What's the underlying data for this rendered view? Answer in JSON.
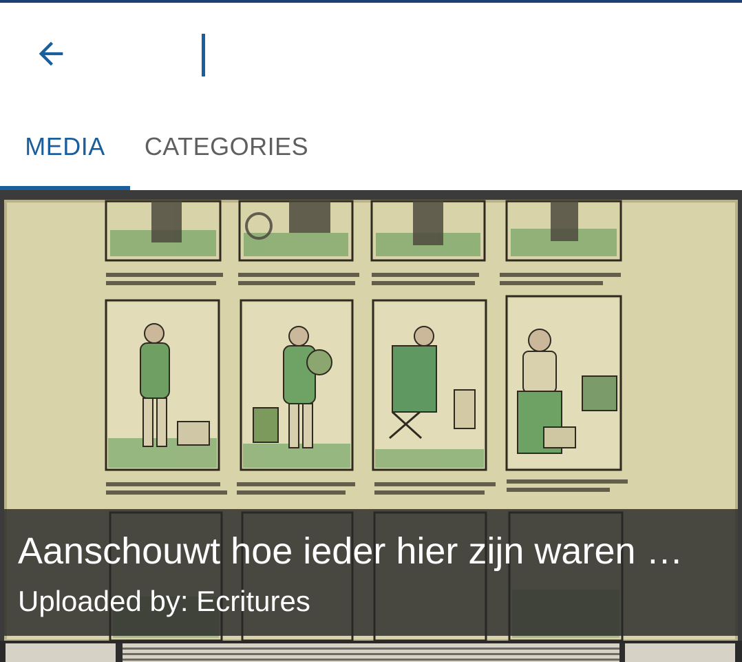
{
  "colors": {
    "accent": "#1b5e9c",
    "top_strip": "#1d3f72",
    "inactive_tab": "#5f5f5f",
    "caption_overlay": "#282828",
    "paper": "#d8d2a8"
  },
  "toolbar": {
    "back_icon": "arrow-left-icon",
    "search_value": "",
    "search_placeholder": ""
  },
  "tabs": [
    {
      "label": "MEDIA",
      "selected": true
    },
    {
      "label": "CATEGORIES",
      "selected": false
    }
  ],
  "results": [
    {
      "title": "Aanschouwt hoe ieder hier zijn waren …",
      "uploader_label": "Uploaded by: Ecritures",
      "image_description_icon": "woodcut-print-thumbnail"
    }
  ]
}
